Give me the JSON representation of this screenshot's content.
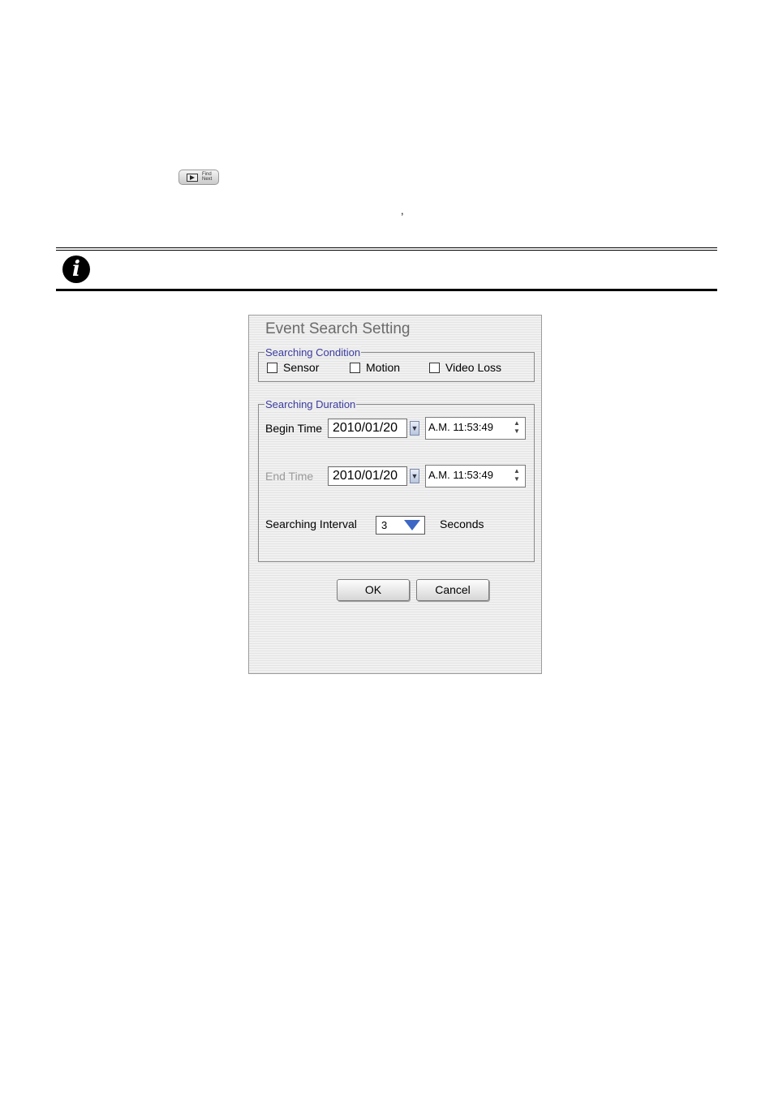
{
  "page": {
    "find_next_button": {
      "label_line1": "Find",
      "label_line2": "Next"
    },
    "comma": ","
  },
  "dialog": {
    "title": "Event Search Setting",
    "searching_condition": {
      "label": "Searching Condition",
      "options": [
        {
          "label": "Sensor",
          "checked": false
        },
        {
          "label": "Motion",
          "checked": false
        },
        {
          "label": "Video Loss",
          "checked": false
        }
      ]
    },
    "searching_duration": {
      "label": "Searching Duration",
      "begin_time": {
        "label": "Begin Time",
        "date": "2010/01/20",
        "time": "A.M. 11:53:49"
      },
      "end_time": {
        "label": "End Time",
        "date": "2010/01/20",
        "time": "A.M. 11:53:49"
      },
      "interval": {
        "label": "Searching Interval",
        "value": "3",
        "unit": "Seconds"
      }
    },
    "buttons": {
      "ok": "OK",
      "cancel": "Cancel"
    }
  },
  "icons": {
    "info": "info-icon",
    "date_dropdown": "chevron-down-icon",
    "spin": "spin-arrows-icon",
    "interval_dropdown": "triangle-down-icon"
  },
  "colors": {
    "group_label": "#3b3ba0",
    "title": "#6b6b6b",
    "disabled_label": "#9a9a9a",
    "dropdown_accent": "#3d67c4"
  }
}
